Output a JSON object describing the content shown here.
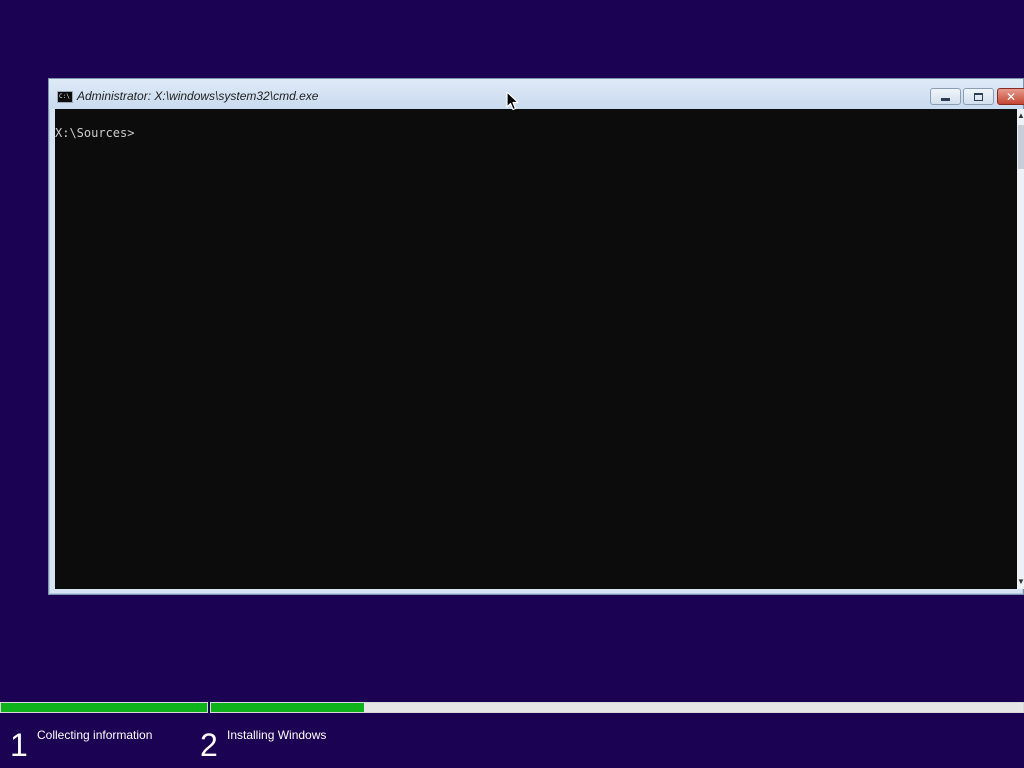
{
  "window": {
    "title": "Administrator: X:\\windows\\system32\\cmd.exe",
    "icon_label": "C:\\",
    "controls": {
      "minimize": "minimize-icon",
      "maximize": "maximize-icon",
      "close": "✕"
    }
  },
  "console": {
    "prompt": "X:\\Sources>"
  },
  "scrollbar": {
    "up": "▲",
    "down": "▼"
  },
  "setup": {
    "steps": [
      {
        "number": "1",
        "label": "Collecting information",
        "progress": 1.0
      },
      {
        "number": "2",
        "label": "Installing Windows",
        "progress": 0.188
      }
    ]
  },
  "colors": {
    "background": "#1c0252",
    "progress_fill": "#10b21b",
    "console_bg": "#0c0c0c",
    "console_text": "#cccccc"
  }
}
